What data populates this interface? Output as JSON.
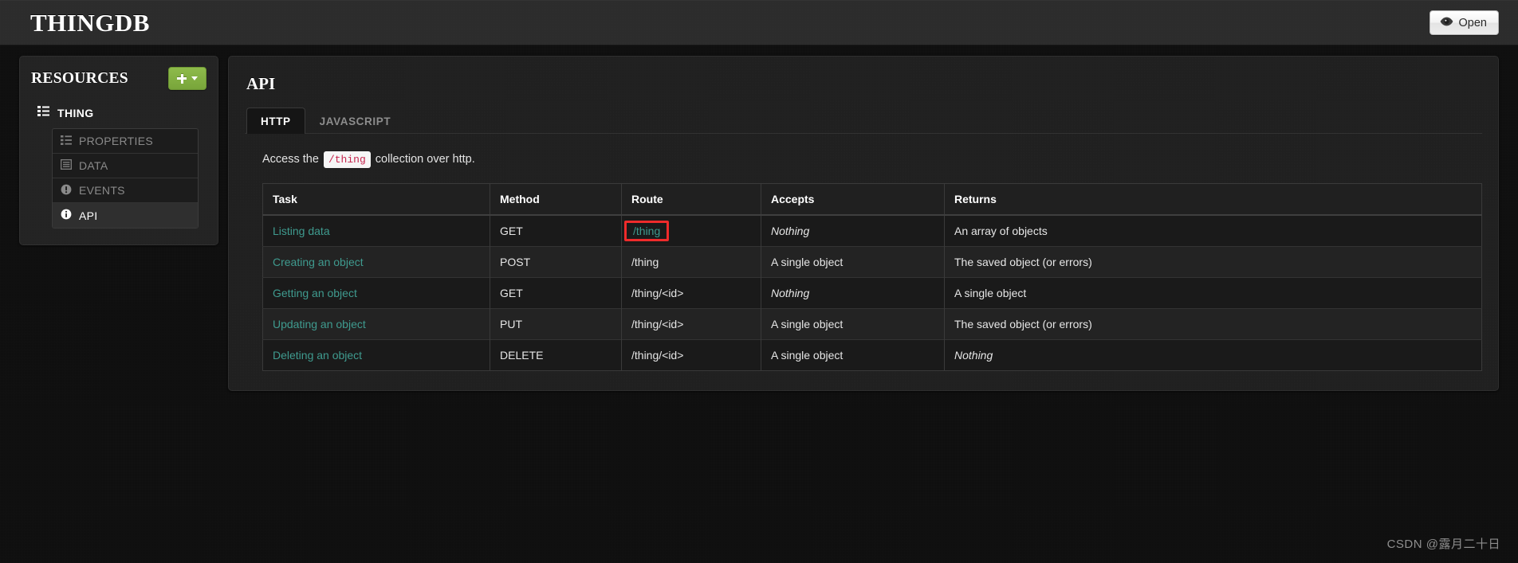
{
  "topbar": {
    "brand": "THINGDB",
    "open_button": {
      "label": "Open",
      "icon": "eye-icon"
    }
  },
  "sidebar": {
    "title": "RESOURCES",
    "add_button": {
      "icon": "plus-icon",
      "caret": "chevron-down-icon"
    },
    "root": {
      "label": "THING",
      "icon": "list-icon"
    },
    "items": [
      {
        "label": "PROPERTIES",
        "icon": "list-icon",
        "active": false
      },
      {
        "label": "DATA",
        "icon": "table-icon",
        "active": false
      },
      {
        "label": "EVENTS",
        "icon": "alert-icon",
        "active": false
      },
      {
        "label": "API",
        "icon": "info-icon",
        "active": true
      }
    ]
  },
  "main": {
    "title": "API",
    "tabs": [
      {
        "label": "HTTP",
        "active": true
      },
      {
        "label": "JAVASCRIPT",
        "active": false
      }
    ],
    "intro": {
      "before": "Access the",
      "code": "/thing",
      "after": "collection over http."
    },
    "table": {
      "headers": [
        "Task",
        "Method",
        "Route",
        "Accepts",
        "Returns"
      ],
      "rows": [
        {
          "task": "Listing data",
          "method": "GET",
          "route": "/thing",
          "route_highlighted": true,
          "accepts": "Nothing",
          "accepts_italic": true,
          "returns": "An array of objects",
          "returns_italic": false
        },
        {
          "task": "Creating an object",
          "method": "POST",
          "route": "/thing",
          "route_highlighted": false,
          "accepts": "A single object",
          "accepts_italic": false,
          "returns": "The saved object (or errors)",
          "returns_italic": false
        },
        {
          "task": "Getting an object",
          "method": "GET",
          "route": "/thing/<id>",
          "route_highlighted": false,
          "accepts": "Nothing",
          "accepts_italic": true,
          "returns": "A single object",
          "returns_italic": false
        },
        {
          "task": "Updating an object",
          "method": "PUT",
          "route": "/thing/<id>",
          "route_highlighted": false,
          "accepts": "A single object",
          "accepts_italic": false,
          "returns": "The saved object (or errors)",
          "returns_italic": false
        },
        {
          "task": "Deleting an object",
          "method": "DELETE",
          "route": "/thing/<id>",
          "route_highlighted": false,
          "accepts": "A single object",
          "accepts_italic": false,
          "returns": "Nothing",
          "returns_italic": true
        }
      ]
    }
  },
  "watermark": "CSDN @露月二十日",
  "colors": {
    "accent_green": "#7fae42",
    "link_teal": "#3f9b8f",
    "annotation_red": "#ef2b2b",
    "code_pink": "#c7254e",
    "page_bg": "#0d0d0d"
  }
}
